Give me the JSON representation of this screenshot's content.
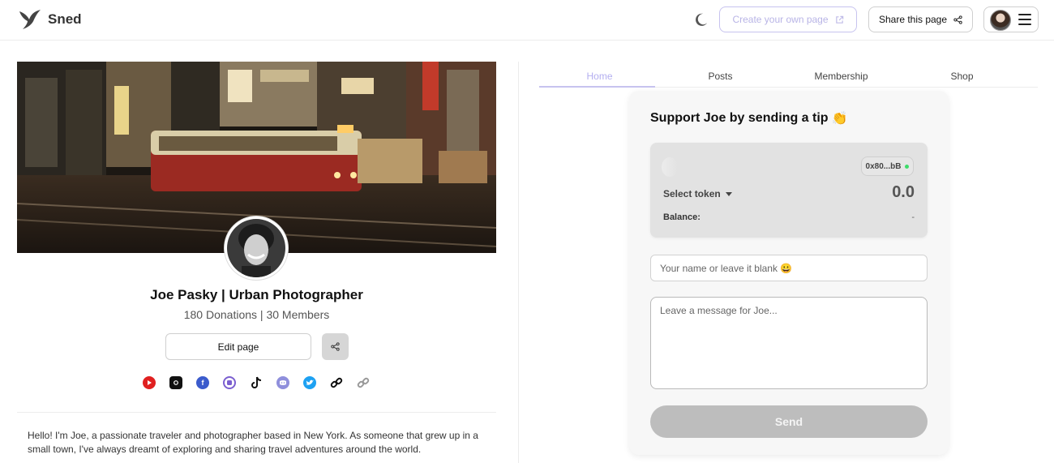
{
  "header": {
    "brand": "Sned",
    "create_page_label": "Create your own page",
    "share_page_label": "Share this page"
  },
  "profile": {
    "name": "Joe Pasky | Urban Photographer",
    "stats": "180 Donations | 30 Members",
    "edit_label": "Edit page",
    "bio": "Hello! I'm Joe, a passionate traveler and photographer based in New York. As someone that grew up in a small town, I've always dreamt of exploring and sharing travel adventures around the world.",
    "socials": [
      {
        "name": "youtube-icon",
        "color": "#e02020"
      },
      {
        "name": "instagram-icon",
        "color": "#111111"
      },
      {
        "name": "facebook-icon",
        "color": "#3b5bcc"
      },
      {
        "name": "mastodon-icon",
        "color": "#7b5fd0"
      },
      {
        "name": "tiktok-icon",
        "color": "#111111"
      },
      {
        "name": "discord-icon",
        "color": "#8f8fdc"
      },
      {
        "name": "twitter-icon",
        "color": "#1da1f2"
      },
      {
        "name": "link-icon",
        "color": "#111111"
      },
      {
        "name": "link-alt-icon",
        "color": "#9a9a9a"
      }
    ]
  },
  "tabs": [
    {
      "label": "Home",
      "active": true
    },
    {
      "label": "Posts",
      "active": false
    },
    {
      "label": "Membership",
      "active": false
    },
    {
      "label": "Shop",
      "active": false
    }
  ],
  "tip": {
    "title": "Support Joe by sending a tip",
    "title_emoji": "👏",
    "wallet_address": "0x80...bB",
    "select_token_label": "Select token",
    "amount": "0.0",
    "balance_label": "Balance:",
    "balance_value": "-",
    "name_placeholder": "Your name or leave it blank 😀",
    "message_placeholder": "Leave a message for Joe...",
    "send_label": "Send"
  },
  "colors": {
    "accent": "#c7c3ef",
    "accent_text": "#b3aef0",
    "send_disabled": "#bdbdbd",
    "status_online": "#3ddc6a"
  }
}
